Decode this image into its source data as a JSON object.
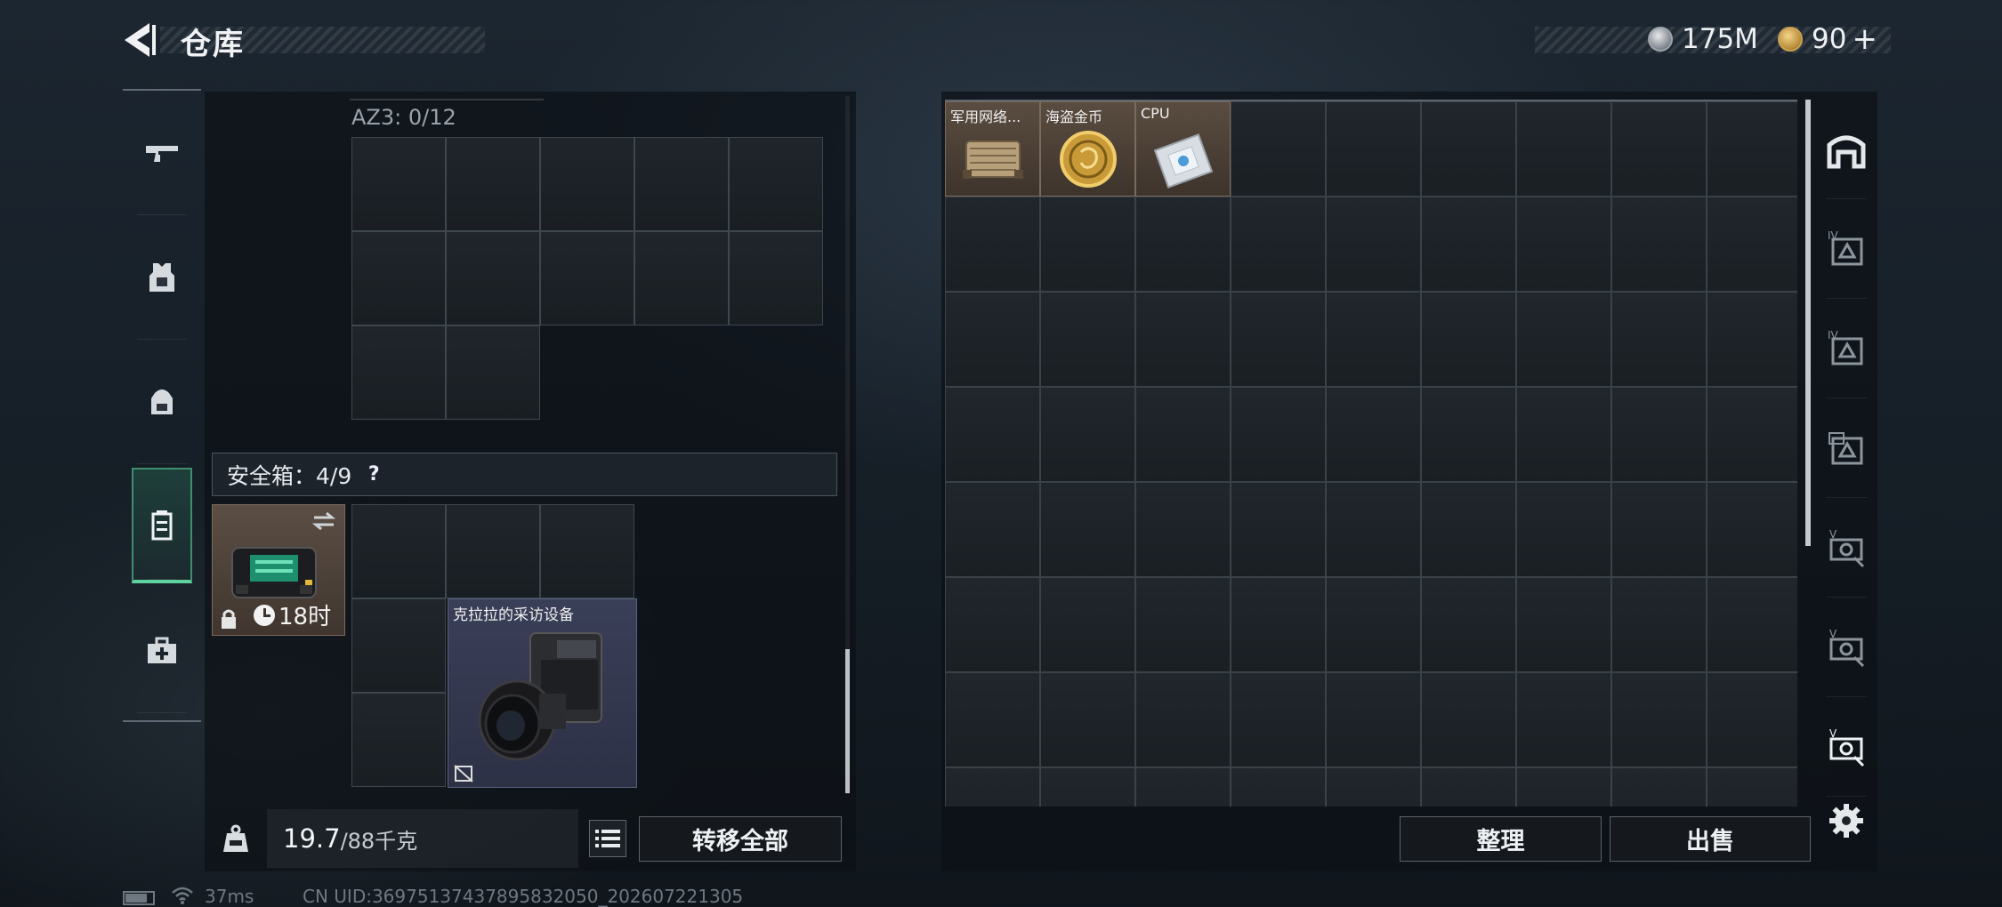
{
  "header": {
    "title": "仓库",
    "currency_silver": "175M",
    "currency_gold": "90",
    "currency_gold_plus": "+"
  },
  "left_nav": {
    "items": [
      {
        "icon": "pistol-icon",
        "active": false
      },
      {
        "icon": "armor-vest-icon",
        "active": false
      },
      {
        "icon": "backpack-icon",
        "active": false
      },
      {
        "icon": "safebox-icon",
        "active": true
      },
      {
        "icon": "medkit-icon",
        "active": false
      }
    ]
  },
  "rig": {
    "label": "AZ3: 0/12"
  },
  "safebox": {
    "label": "安全箱：4/9",
    "help": "?",
    "timer": "18时",
    "item_name": "克拉拉的采访设备"
  },
  "footer_left": {
    "weight_current": "19.7",
    "weight_max": "/88千克",
    "transfer_all": "转移全部"
  },
  "stash": {
    "items": [
      {
        "name": "军用网络...",
        "icon": "network-device-icon"
      },
      {
        "name": "海盗金币",
        "icon": "gold-coin-icon"
      },
      {
        "name": "CPU",
        "icon": "cpu-icon"
      }
    ],
    "sort_label": "整理",
    "sell_label": "出售"
  },
  "right_tabs": [
    {
      "icon": "stash-home-icon",
      "label": ""
    },
    {
      "icon": "tier-iv-stash-icon",
      "label": "IV"
    },
    {
      "icon": "tier-iv-stash-icon",
      "label": "IV"
    },
    {
      "icon": "tier-stash-icon",
      "label": ""
    },
    {
      "icon": "tier-v-stash-icon",
      "label": "V"
    },
    {
      "icon": "tier-v-stash-icon",
      "label": "V"
    },
    {
      "icon": "tier-v-stash-icon",
      "label": "V"
    },
    {
      "icon": "settings-gear-icon",
      "label": ""
    }
  ],
  "status_bar": {
    "ping": "37ms",
    "uid": "CN UID:36975137437895832050_202607221305"
  },
  "colors": {
    "accent_green": "#5fd29e",
    "item_brown": "#5a4c40",
    "item_purple": "#3a3f58"
  }
}
